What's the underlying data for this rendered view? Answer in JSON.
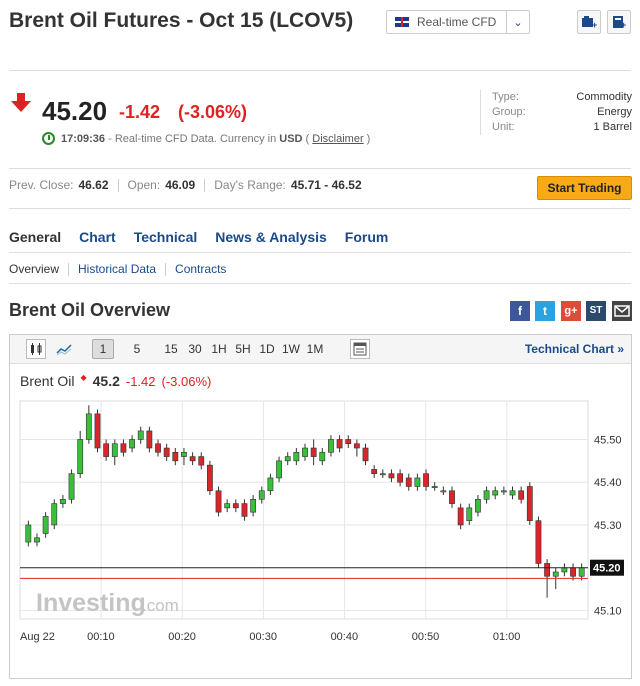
{
  "header": {
    "title": "Brent Oil Futures - Oct 15 (LCOV5)",
    "cfd_select": "Real-time CFD"
  },
  "quote": {
    "price": "45.20",
    "change": "-1.42",
    "change_pct": "(-3.06%)",
    "time": "17:09:36",
    "time_text": "- Real-time CFD Data. Currency in",
    "currency": "USD",
    "disclaimer": "Disclaimer"
  },
  "meta": [
    {
      "label": "Type:",
      "value": "Commodity"
    },
    {
      "label": "Group:",
      "value": "Energy"
    },
    {
      "label": "Unit:",
      "value": "1 Barrel"
    }
  ],
  "stats": {
    "prev_close_label": "Prev. Close:",
    "prev_close": "46.62",
    "open_label": "Open:",
    "open": "46.09",
    "range_label": "Day's Range:",
    "range": "45.71 - 46.52"
  },
  "start_trading": "Start Trading",
  "tabs": [
    "General",
    "Chart",
    "Technical",
    "News & Analysis",
    "Forum"
  ],
  "subtabs": [
    "Overview",
    "Historical Data",
    "Contracts"
  ],
  "section_title": "Brent Oil Overview",
  "social": {
    "facebook": "f",
    "twitter": "t",
    "google": "g+",
    "stocktwits": "ST"
  },
  "toolbar": {
    "intervals": [
      "1",
      "5",
      "15",
      "30",
      "1H",
      "5H",
      "1D",
      "1W",
      "1M"
    ],
    "active_interval": "1",
    "technical_chart": "Technical Chart »"
  },
  "legend": {
    "name": "Brent Oil",
    "price": "45.2",
    "change": "-1.42",
    "change_pct": "(-3.06%)"
  },
  "watermark": {
    "brand": "Investing",
    "suffix": ".com"
  },
  "colors": {
    "up": "#3bbf3b",
    "down": "#d9262b",
    "accent": "#f7a917",
    "link": "#1a4a8a"
  },
  "chart_data": {
    "type": "candlestick",
    "x_ticks": [
      "Aug 22",
      "00:10",
      "00:20",
      "00:30",
      "00:40",
      "00:50",
      "01:00"
    ],
    "y_ticks": [
      45.5,
      45.4,
      45.3,
      45.1
    ],
    "ylim": [
      45.08,
      45.59
    ],
    "last_price": 45.2,
    "last_price_label": "45.20",
    "prev_close_line": 45.175,
    "candles": [
      {
        "o": 45.26,
        "c": 45.3,
        "h": 45.31,
        "l": 45.25
      },
      {
        "o": 45.26,
        "c": 45.27,
        "h": 45.28,
        "l": 45.25
      },
      {
        "o": 45.28,
        "c": 45.32,
        "h": 45.33,
        "l": 45.27
      },
      {
        "o": 45.3,
        "c": 45.35,
        "h": 45.36,
        "l": 45.29
      },
      {
        "o": 45.35,
        "c": 45.36,
        "h": 45.37,
        "l": 45.34
      },
      {
        "o": 45.36,
        "c": 45.42,
        "h": 45.43,
        "l": 45.35
      },
      {
        "o": 45.42,
        "c": 45.5,
        "h": 45.52,
        "l": 45.41
      },
      {
        "o": 45.5,
        "c": 45.56,
        "h": 45.58,
        "l": 45.49
      },
      {
        "o": 45.56,
        "c": 45.48,
        "h": 45.57,
        "l": 45.47
      },
      {
        "o": 45.49,
        "c": 45.46,
        "h": 45.5,
        "l": 45.45
      },
      {
        "o": 45.46,
        "c": 45.49,
        "h": 45.5,
        "l": 45.44
      },
      {
        "o": 45.49,
        "c": 45.47,
        "h": 45.5,
        "l": 45.46
      },
      {
        "o": 45.48,
        "c": 45.5,
        "h": 45.51,
        "l": 45.47
      },
      {
        "o": 45.5,
        "c": 45.52,
        "h": 45.53,
        "l": 45.49
      },
      {
        "o": 45.52,
        "c": 45.48,
        "h": 45.53,
        "l": 45.47
      },
      {
        "o": 45.49,
        "c": 45.47,
        "h": 45.5,
        "l": 45.46
      },
      {
        "o": 45.48,
        "c": 45.46,
        "h": 45.49,
        "l": 45.45
      },
      {
        "o": 45.47,
        "c": 45.45,
        "h": 45.48,
        "l": 45.44
      },
      {
        "o": 45.46,
        "c": 45.47,
        "h": 45.48,
        "l": 45.44
      },
      {
        "o": 45.46,
        "c": 45.45,
        "h": 45.47,
        "l": 45.44
      },
      {
        "o": 45.46,
        "c": 45.44,
        "h": 45.47,
        "l": 45.43
      },
      {
        "o": 45.44,
        "c": 45.38,
        "h": 45.45,
        "l": 45.37
      },
      {
        "o": 45.38,
        "c": 45.33,
        "h": 45.39,
        "l": 45.32
      },
      {
        "o": 45.34,
        "c": 45.35,
        "h": 45.36,
        "l": 45.33
      },
      {
        "o": 45.35,
        "c": 45.34,
        "h": 45.36,
        "l": 45.33
      },
      {
        "o": 45.35,
        "c": 45.32,
        "h": 45.36,
        "l": 45.31
      },
      {
        "o": 45.33,
        "c": 45.36,
        "h": 45.37,
        "l": 45.32
      },
      {
        "o": 45.36,
        "c": 45.38,
        "h": 45.39,
        "l": 45.35
      },
      {
        "o": 45.38,
        "c": 45.41,
        "h": 45.42,
        "l": 45.37
      },
      {
        "o": 45.41,
        "c": 45.45,
        "h": 45.46,
        "l": 45.4
      },
      {
        "o": 45.45,
        "c": 45.46,
        "h": 45.47,
        "l": 45.44
      },
      {
        "o": 45.45,
        "c": 45.47,
        "h": 45.48,
        "l": 45.44
      },
      {
        "o": 45.46,
        "c": 45.48,
        "h": 45.49,
        "l": 45.45
      },
      {
        "o": 45.48,
        "c": 45.46,
        "h": 45.5,
        "l": 45.44
      },
      {
        "o": 45.45,
        "c": 45.47,
        "h": 45.48,
        "l": 45.44
      },
      {
        "o": 45.47,
        "c": 45.5,
        "h": 45.51,
        "l": 45.46
      },
      {
        "o": 45.5,
        "c": 45.48,
        "h": 45.51,
        "l": 45.47
      },
      {
        "o": 45.5,
        "c": 45.49,
        "h": 45.51,
        "l": 45.48
      },
      {
        "o": 45.49,
        "c": 45.48,
        "h": 45.5,
        "l": 45.46
      },
      {
        "o": 45.48,
        "c": 45.45,
        "h": 45.49,
        "l": 45.44
      },
      {
        "o": 45.43,
        "c": 45.42,
        "h": 45.44,
        "l": 45.41
      },
      {
        "o": 45.42,
        "c": 45.42,
        "h": 45.43,
        "l": 45.41
      },
      {
        "o": 45.42,
        "c": 45.41,
        "h": 45.43,
        "l": 45.4
      },
      {
        "o": 45.42,
        "c": 45.4,
        "h": 45.43,
        "l": 45.39
      },
      {
        "o": 45.41,
        "c": 45.39,
        "h": 45.42,
        "l": 45.38
      },
      {
        "o": 45.39,
        "c": 45.41,
        "h": 45.42,
        "l": 45.38
      },
      {
        "o": 45.42,
        "c": 45.39,
        "h": 45.43,
        "l": 45.38
      },
      {
        "o": 45.39,
        "c": 45.39,
        "h": 45.4,
        "l": 45.38
      },
      {
        "o": 45.38,
        "c": 45.38,
        "h": 45.39,
        "l": 45.37
      },
      {
        "o": 45.38,
        "c": 45.35,
        "h": 45.39,
        "l": 45.34
      },
      {
        "o": 45.34,
        "c": 45.3,
        "h": 45.35,
        "l": 45.29
      },
      {
        "o": 45.31,
        "c": 45.34,
        "h": 45.35,
        "l": 45.3
      },
      {
        "o": 45.33,
        "c": 45.36,
        "h": 45.37,
        "l": 45.32
      },
      {
        "o": 45.36,
        "c": 45.38,
        "h": 45.39,
        "l": 45.35
      },
      {
        "o": 45.37,
        "c": 45.38,
        "h": 45.39,
        "l": 45.36
      },
      {
        "o": 45.38,
        "c": 45.38,
        "h": 45.39,
        "l": 45.37
      },
      {
        "o": 45.37,
        "c": 45.38,
        "h": 45.39,
        "l": 45.36
      },
      {
        "o": 45.38,
        "c": 45.36,
        "h": 45.39,
        "l": 45.35
      },
      {
        "o": 45.39,
        "c": 45.31,
        "h": 45.4,
        "l": 45.3
      },
      {
        "o": 45.31,
        "c": 45.21,
        "h": 45.32,
        "l": 45.2
      },
      {
        "o": 45.21,
        "c": 45.18,
        "h": 45.22,
        "l": 45.13
      },
      {
        "o": 45.18,
        "c": 45.19,
        "h": 45.2,
        "l": 45.15
      },
      {
        "o": 45.19,
        "c": 45.2,
        "h": 45.21,
        "l": 45.18
      },
      {
        "o": 45.2,
        "c": 45.18,
        "h": 45.21,
        "l": 45.17
      },
      {
        "o": 45.18,
        "c": 45.2,
        "h": 45.21,
        "l": 45.17
      }
    ]
  }
}
